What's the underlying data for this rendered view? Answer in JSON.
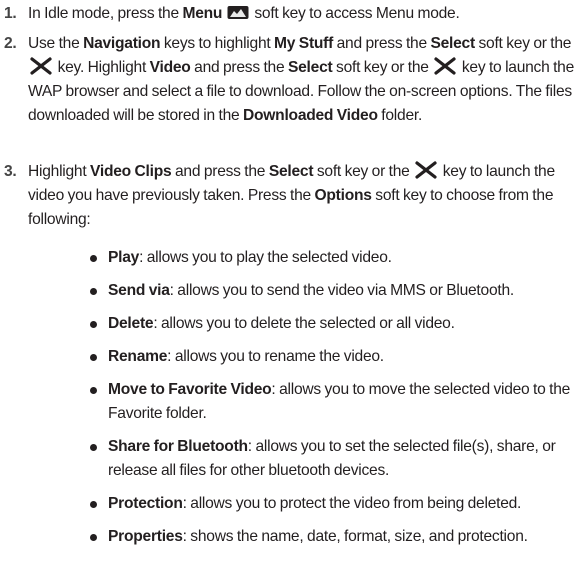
{
  "steps": [
    {
      "num": "1.",
      "a": "In Idle mode, press the ",
      "menu": "Menu",
      "b": " soft key to access Menu mode."
    },
    {
      "num": "2.",
      "a": "Use the ",
      "navigation": "Navigation",
      "b": " keys to highlight ",
      "mystuff": "My Stuff",
      "c": " and press the ",
      "select1": "Select",
      "d": " soft key or the ",
      "e": " key. Highlight ",
      "video": "Video",
      "f": " and press the ",
      "select2": "Select",
      "g": " soft key or the ",
      "h": " key to launch the WAP browser and select a file to download. Follow the on-screen options. The files downloaded will be stored in the ",
      "downloaded": "Downloaded Video",
      "i": " folder."
    },
    {
      "num": "3.",
      "a": "Highlight ",
      "videoclips": "Video Clips",
      "b": " and press the ",
      "select": "Select",
      "c": " soft key or the ",
      "d": " key to launch the video you have previously taken. Press the ",
      "options": "Options",
      "e": " soft key to choose from the following:"
    }
  ],
  "options": [
    {
      "term": "Play",
      "desc": ": allows you to play the selected video."
    },
    {
      "term": "Send via",
      "desc": ": allows you to send the video via MMS or Bluetooth."
    },
    {
      "term": "Delete",
      "desc": ": allows you to delete the selected or all video."
    },
    {
      "term": "Rename",
      "desc": ": allows you to rename the video."
    },
    {
      "term": "Move to Favorite Video",
      "desc": ": allows you to move the selected video to the Favorite folder."
    },
    {
      "term": "Share for Bluetooth",
      "desc": ": allows you to set the selected file(s), share, or release all files for other bluetooth devices."
    },
    {
      "term": "Protection",
      "desc": ": allows you to protect the video from being deleted."
    },
    {
      "term": "Properties",
      "desc": ": shows the name, date, format, size, and protection."
    }
  ],
  "icons": {
    "menu": "menu-softkey-icon",
    "select": "select-key-icon"
  }
}
